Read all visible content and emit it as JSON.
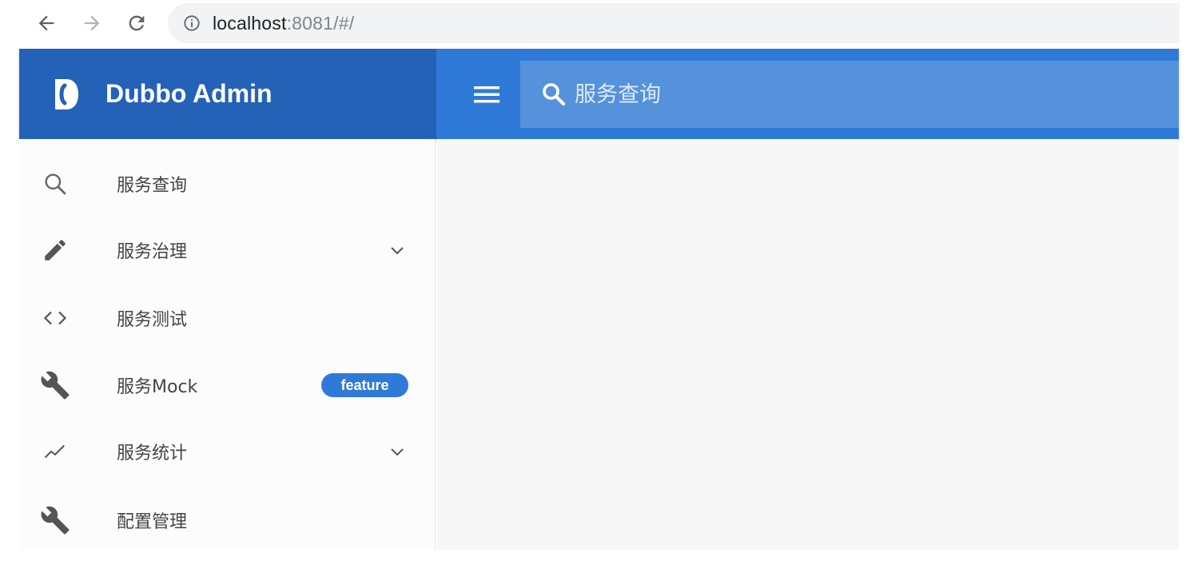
{
  "browser": {
    "back_icon": "arrow-left-icon",
    "forward_icon": "arrow-right-icon",
    "reload_icon": "reload-icon",
    "info_icon": "info-circle-icon",
    "url_host": "localhost",
    "url_rest": ":8081/#/"
  },
  "app": {
    "title": "Dubbo Admin",
    "logo_icon": "dubbo-logo-icon",
    "menu_icon": "hamburger-menu-icon",
    "search": {
      "icon": "search-icon",
      "placeholder": "服务查询"
    }
  },
  "sidebar": {
    "items": [
      {
        "label": "服务查询",
        "icon": "search-icon",
        "has_chevron": false
      },
      {
        "label": "服务治理",
        "icon": "pencil-icon",
        "has_chevron": true
      },
      {
        "label": "服务测试",
        "icon": "code-icon",
        "has_chevron": false
      },
      {
        "label": "服务Mock",
        "icon": "wrench-icon",
        "badge": "feature"
      },
      {
        "label": "服务统计",
        "icon": "trending-line-icon",
        "has_chevron": true
      },
      {
        "label": "配置管理",
        "icon": "wrench-icon",
        "has_chevron": false
      }
    ]
  },
  "colors": {
    "header_brand": "#2462b8",
    "header_bar": "#2f7ad8",
    "search_bg": "#5592db",
    "badge_bg": "#2f7ad8",
    "icon_gray": "#555555"
  }
}
